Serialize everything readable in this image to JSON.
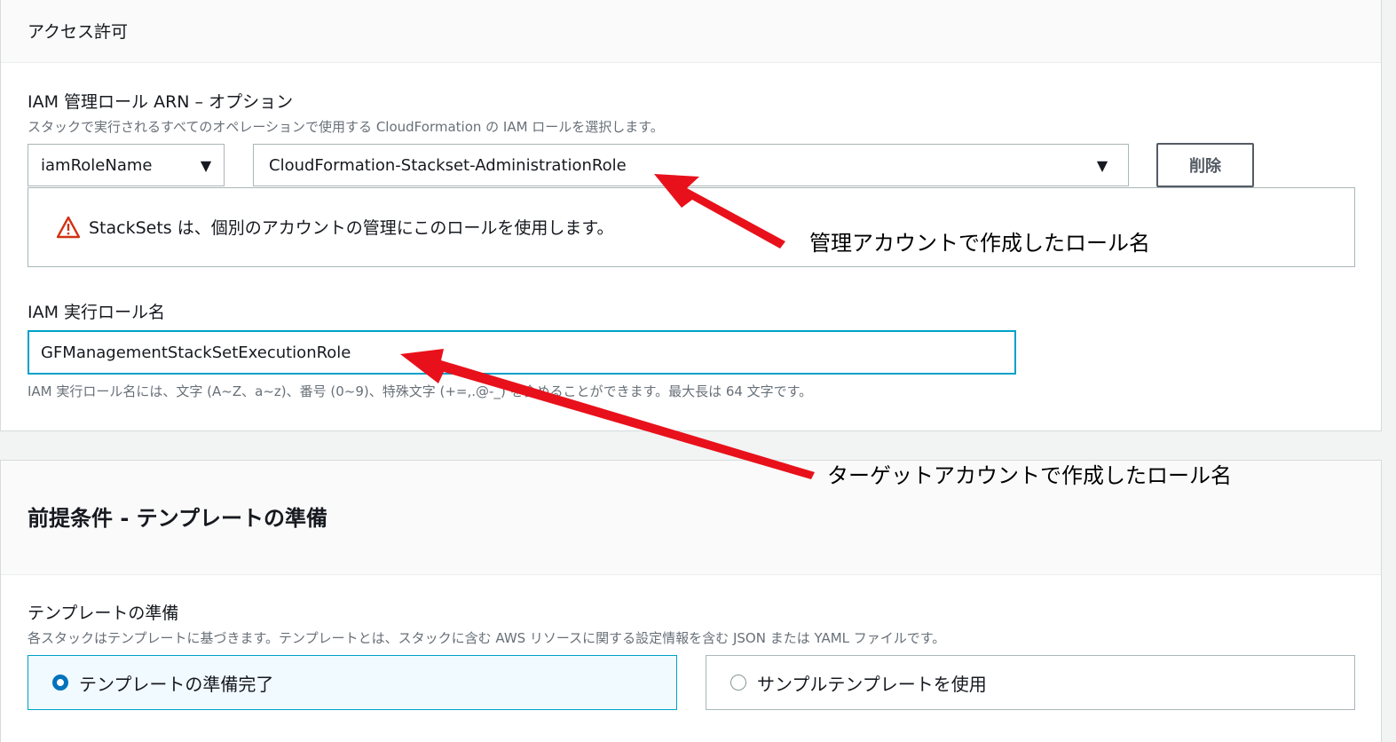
{
  "access": {
    "title": "アクセス許可",
    "admin_role": {
      "label": "IAM 管理ロール ARN – オプション",
      "description": "スタックで実行されるすべてのオペレーションで使用する CloudFormation の IAM ロールを選択します。",
      "type_select_value": "iamRoleName",
      "role_select_value": "CloudFormation-Stackset-AdministrationRole",
      "delete_label": "削除"
    },
    "alert_text": "StackSets は、個別のアカウントの管理にこのロールを使用します。",
    "exec_role": {
      "label": "IAM 実行ロール名",
      "value": "GFManagementStackSetExecutionRole",
      "hint": "IAM 実行ロール名には、文字 (A~Z、a~z)、番号 (0~9)、特殊文字 (+=,.@-_) を含めることができます。最大長は 64 文字です。"
    }
  },
  "prereq": {
    "title": "前提条件 - テンプレートの準備",
    "template_label": "テンプレートの準備",
    "template_description": "各スタックはテンプレートに基づきます。テンプレートとは、スタックに含む AWS リソースに関する設定情報を含む JSON または YAML ファイルです。",
    "options": [
      {
        "label": "テンプレートの準備完了",
        "selected": true
      },
      {
        "label": "サンプルテンプレートを使用",
        "selected": false
      }
    ]
  },
  "annotations": {
    "admin_note": "管理アカウントで作成したロール名",
    "target_note": "ターゲットアカウントで作成したロール名"
  },
  "colors": {
    "arrow": "#e8111b",
    "focus": "#00a1c9",
    "selected_radio": "#0073bb",
    "warning": "#d13212"
  },
  "icons": {
    "caret": "▼",
    "warning": "warning-triangle-icon"
  }
}
